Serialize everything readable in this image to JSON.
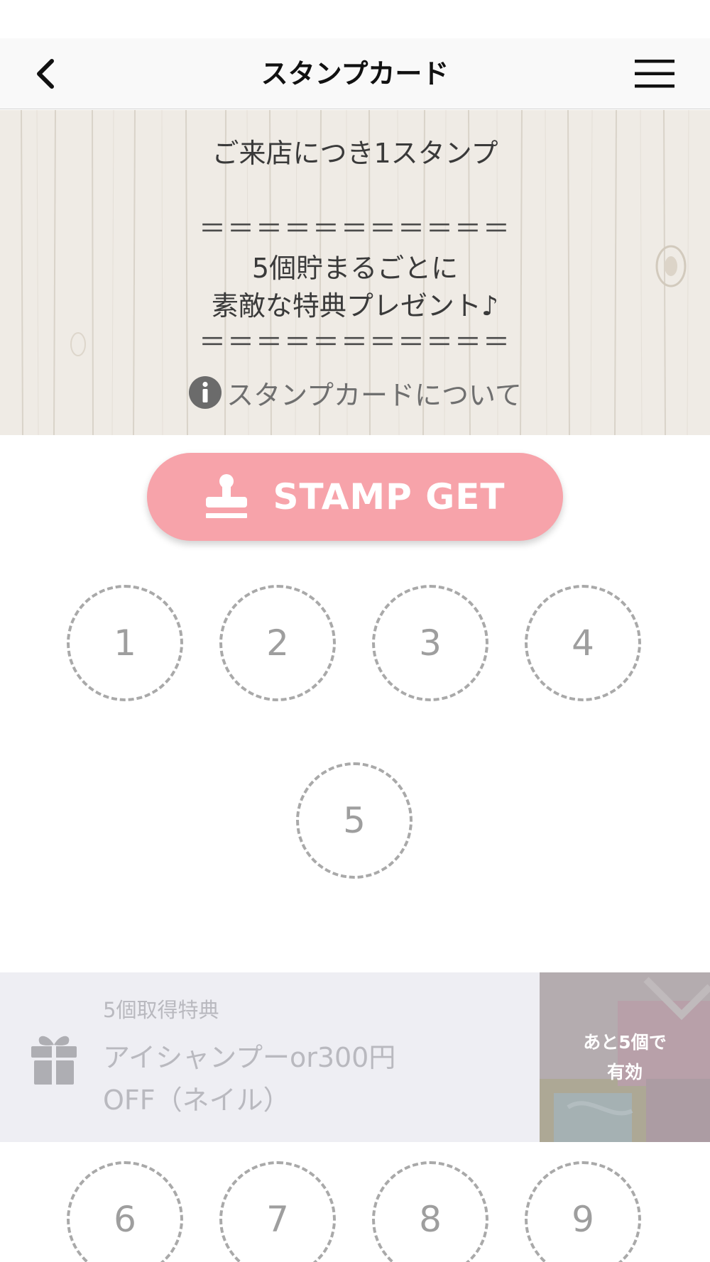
{
  "header": {
    "title": "スタンプカード",
    "back_icon": "chevron-left-icon",
    "menu_icon": "hamburger-menu-icon"
  },
  "banner": {
    "line1": "ご来店につき1スタンプ",
    "separator": "＝＝＝＝＝＝＝＝＝＝＝",
    "line2": "5個貯まるごとに",
    "line3": "素敵な特典プレゼント♪",
    "about_link": "スタンプカードについて",
    "about_icon": "info-icon"
  },
  "stamp_button": {
    "label": "STAMP GET",
    "icon": "stamp-icon",
    "color": "#f7a3aa"
  },
  "stamp_slots_group1": [
    "1",
    "2",
    "3",
    "4",
    "5"
  ],
  "reward": {
    "caption": "5個取得特典",
    "title_line1": "アイシャンプーor300円",
    "title_line2": "OFF（ネイル）",
    "status_line1": "あと5個で",
    "status_line2": "有効",
    "icon": "gift-icon"
  },
  "stamp_slots_group2": [
    "6",
    "7",
    "8",
    "9"
  ]
}
